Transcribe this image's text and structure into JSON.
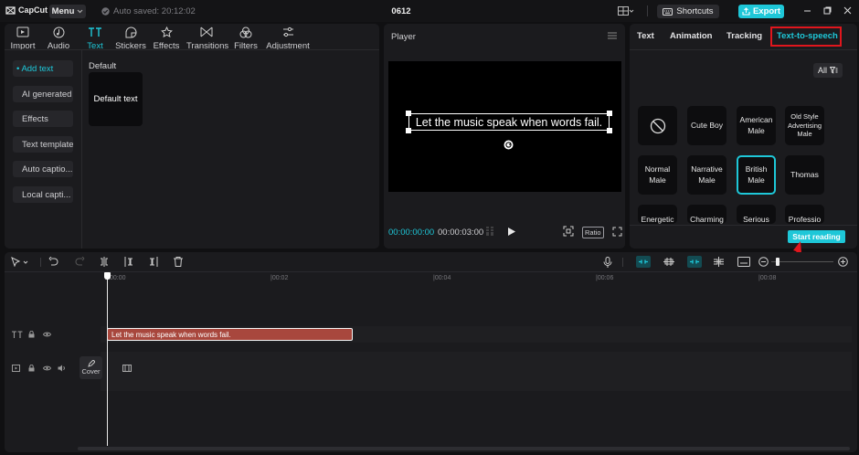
{
  "app": {
    "logo": "CapCut",
    "menu_label": "Menu",
    "saved_status": "Auto saved: 20:12:02",
    "project_title": "0612",
    "shortcuts_label": "Shortcuts",
    "export_label": "Export"
  },
  "toolbar": {
    "tabs": [
      {
        "label": "Import",
        "icon": "import-icon"
      },
      {
        "label": "Audio",
        "icon": "audio-icon"
      },
      {
        "label": "Text",
        "icon": "text-icon",
        "active": true
      },
      {
        "label": "Stickers",
        "icon": "stickers-icon"
      },
      {
        "label": "Effects",
        "icon": "effects-icon"
      },
      {
        "label": "Transitions",
        "icon": "transitions-icon"
      },
      {
        "label": "Filters",
        "icon": "filters-icon"
      },
      {
        "label": "Adjustment",
        "icon": "adjustment-icon"
      }
    ]
  },
  "text_sidebar": {
    "items": [
      "• Add text",
      "AI generated",
      "Effects",
      "Text template",
      "Auto captio...",
      "Local capti..."
    ]
  },
  "text_library": {
    "category": "Default",
    "card_label": "Default text"
  },
  "player": {
    "label": "Player",
    "caption": "Let the music speak when words fail.",
    "current_time": "00:00:00:00",
    "duration": "00:00:03:00",
    "ratio_label": "Ratio"
  },
  "right_panel": {
    "tabs": [
      "Text",
      "Animation",
      "Tracking",
      "Text-to-speech"
    ],
    "active_tab": "Text-to-speech",
    "filter_label": "All",
    "voices": [
      "",
      "Cute Boy",
      "American Male",
      "Old Style Advertising Male",
      "Normal Male",
      "Narrative Male",
      "British Male",
      "Thomas",
      "Energetic",
      "Charming",
      "Serious",
      "Professio"
    ],
    "selected_voice": "British Male",
    "start_button": "Start reading"
  },
  "timeline": {
    "ruler": [
      "00:00",
      "|00:02",
      "|00:04",
      "|00:06",
      "|00:08"
    ],
    "text_clip": "Let the music speak when words fail.",
    "cover_label": "Cover"
  },
  "colors": {
    "accent": "#1ec7d8",
    "highlight": "#e0161d",
    "text_clip": "#a8473d"
  }
}
